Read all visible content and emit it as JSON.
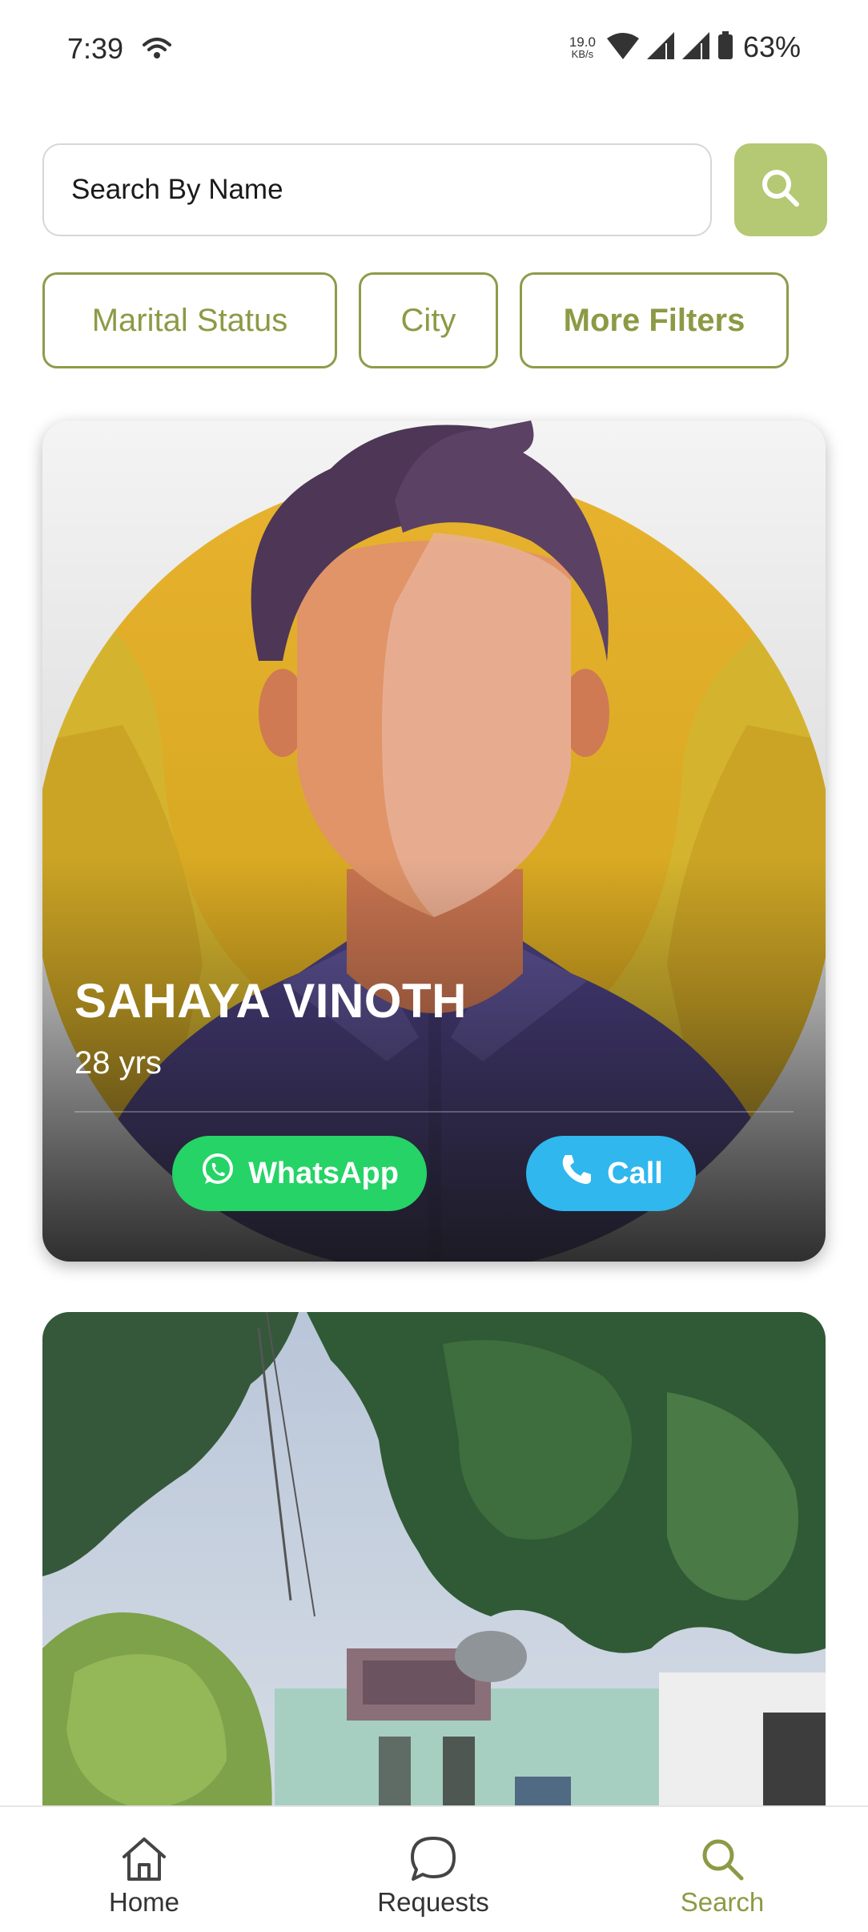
{
  "status_bar": {
    "time": "7:39",
    "network_speed_value": "19.0",
    "network_speed_unit": "KB/s",
    "battery_percent": "63%"
  },
  "search": {
    "placeholder": "Search By Name",
    "button_icon": "search-icon",
    "button_color": "#b5c874"
  },
  "filters": {
    "marital_status": "Marital Status",
    "city": "City",
    "more_filters": "More Filters",
    "accent_color": "#8c9a45"
  },
  "profiles": [
    {
      "name": "SAHAYA VINOTH",
      "age": "28 yrs",
      "whatsapp_label": "WhatsApp",
      "call_label": "Call"
    }
  ],
  "bottom_nav": {
    "home": "Home",
    "requests": "Requests",
    "search": "Search",
    "active": "search"
  },
  "colors": {
    "whatsapp": "#25d366",
    "call": "#2fb7ee",
    "active_nav": "#8c9a45"
  }
}
